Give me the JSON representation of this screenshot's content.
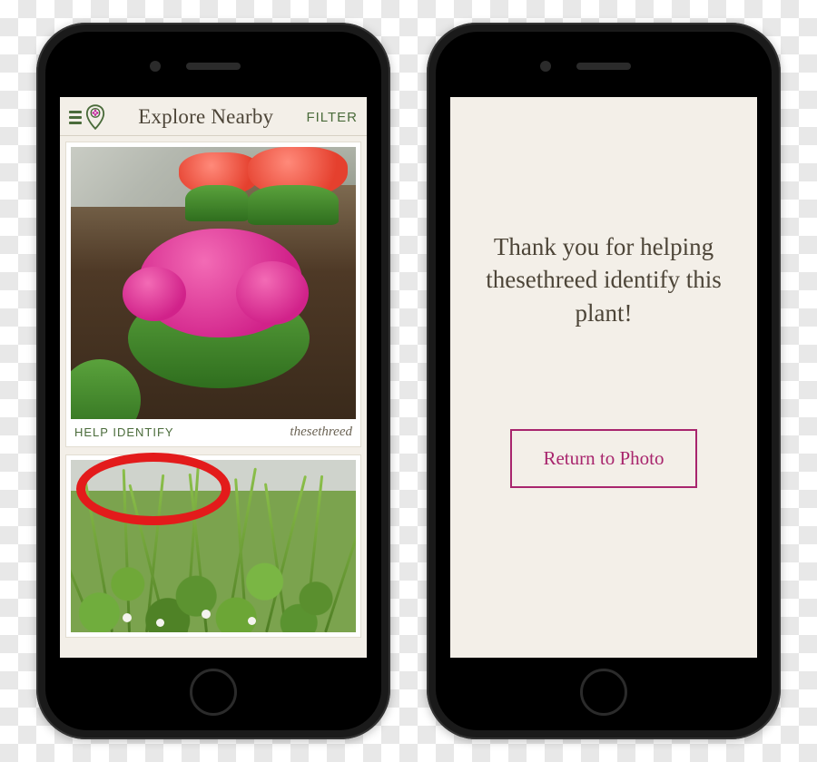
{
  "left": {
    "header": {
      "title": "Explore Nearby",
      "filter_label": "FILTER"
    },
    "cards": [
      {
        "help_label": "HELP IDENTIFY",
        "username": "thesethreed"
      }
    ]
  },
  "right": {
    "thank_you_text": "Thank you for helping thesethreed identify this plant!",
    "return_label": "Return to Photo"
  },
  "colors": {
    "accent_green": "#4a6b3a",
    "accent_magenta": "#a8256d",
    "highlight_red": "#e31b1b",
    "text_body": "#4d4538"
  },
  "icons": {
    "menu": "menu-icon",
    "logo_pin": "flower-pin-icon"
  }
}
